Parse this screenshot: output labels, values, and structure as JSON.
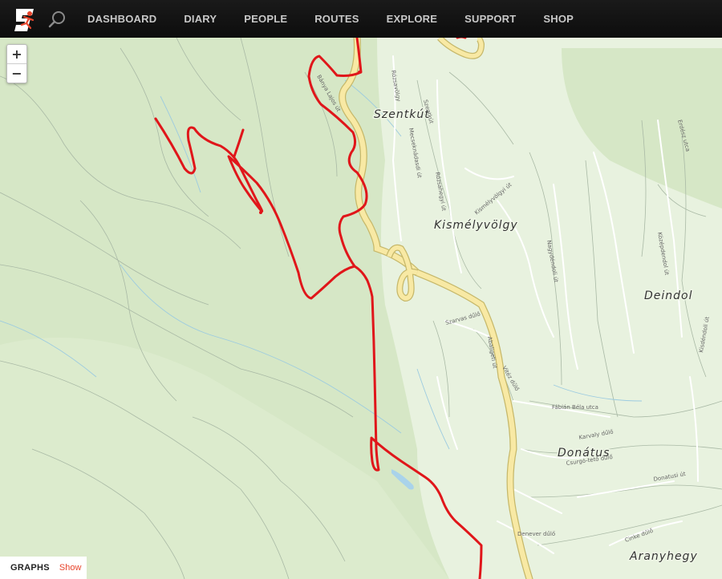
{
  "nav": {
    "logo_icon": "strava-runner-logo-icon",
    "search_icon": "search-icon",
    "items": [
      {
        "label": "DASHBOARD"
      },
      {
        "label": "DIARY"
      },
      {
        "label": "PEOPLE"
      },
      {
        "label": "ROUTES"
      },
      {
        "label": "EXPLORE"
      },
      {
        "label": "SUPPORT"
      },
      {
        "label": "SHOP"
      }
    ]
  },
  "map_controls": {
    "zoom_in": "+",
    "zoom_out": "−"
  },
  "places": [
    {
      "name": "Szentkút"
    },
    {
      "name": "Kismélyvölgy"
    },
    {
      "name": "Deindol"
    },
    {
      "name": "Donátus"
    },
    {
      "name": "Aranyhegy"
    }
  ],
  "streets": [
    {
      "name": "Szentkút"
    },
    {
      "name": "Bánya Lajos út"
    },
    {
      "name": "Rózsavölgy"
    },
    {
      "name": "Mecseknádasdi út"
    },
    {
      "name": "Rózsahegyi út"
    },
    {
      "name": "Kismélyvölgyi út"
    },
    {
      "name": "Abaligeti út"
    },
    {
      "name": "Szarvas dűlő"
    },
    {
      "name": "Donátus"
    },
    {
      "name": "Fábián Béla utca"
    },
    {
      "name": "Karvaly dűlő"
    },
    {
      "name": "Csurgó-tető dűlő"
    },
    {
      "name": "Denever dűlő"
    },
    {
      "name": "Cinke dűlő"
    },
    {
      "name": "Donatusi út"
    },
    {
      "name": "Középdendol út"
    },
    {
      "name": "Nagydéndoli út"
    },
    {
      "name": "Kisdéndoli út"
    },
    {
      "name": "Erdész utca"
    },
    {
      "name": "Vitéz dűlő"
    }
  ],
  "graphs_panel": {
    "title": "GRAPHS",
    "show_label": "Show"
  },
  "colors": {
    "route": "#e0161a",
    "road_main": "#f5e6a0",
    "forest": "#d7e8c8",
    "urban": "#e9f2e2",
    "header": "#111111",
    "accent": "#e8452c"
  }
}
